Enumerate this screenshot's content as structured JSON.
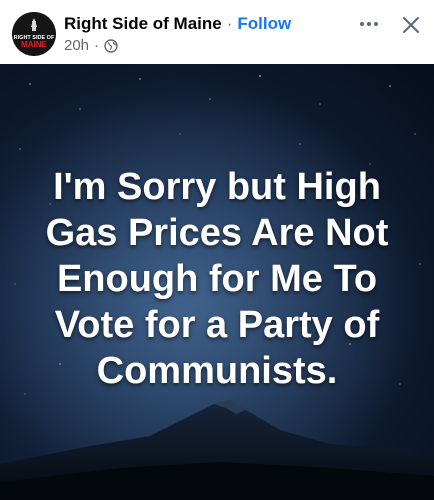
{
  "post": {
    "author": "Right Side of Maine",
    "separator": "·",
    "follow_label": "Follow",
    "time": "20h",
    "meta_separator": "·",
    "privacy_icon": "globe-icon",
    "more_icon": "more-horizontal-icon",
    "close_icon": "close-icon",
    "avatar": {
      "logo_text_line1": "RIGHT SIDE OF",
      "logo_text_line2": "MAINE"
    }
  },
  "image": {
    "text": "I'm Sorry but High\nGas Prices Are Not\nEnough for Me To\nVote for a Party of\nCommunists."
  },
  "colors": {
    "accent": "#1877f2",
    "text_primary": "#050505",
    "text_secondary": "#65676b",
    "sky_dark": "#070e1c",
    "sky_light": "#2d4c72"
  }
}
